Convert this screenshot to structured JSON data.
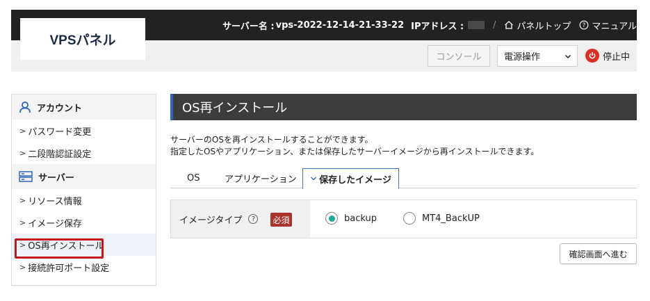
{
  "header": {
    "logo": "VPSパネル",
    "server_name_label": "サーバー名 :",
    "server_name_value": "vps-2022-12-14-21-33-22",
    "ip_label": "IPアドレス :",
    "separator": "/",
    "panel_top_label": "パネルトップ",
    "manual_label": "マニュアル"
  },
  "toolbar": {
    "console_label": "コンソール",
    "power_select_value": "電源操作",
    "status_text": "停止中",
    "status_color": "#d93025"
  },
  "sidebar": {
    "account_heading": "アカウント",
    "account_items": [
      {
        "label": "パスワード変更"
      },
      {
        "label": "二段階認証設定"
      }
    ],
    "server_heading": "サーバー",
    "server_items": [
      {
        "label": "リソース情報"
      },
      {
        "label": "イメージ保存"
      },
      {
        "label": "OS再インストール"
      },
      {
        "label": "接続許可ポート設定"
      }
    ]
  },
  "main": {
    "title": "OS再インストール",
    "desc_line1": "サーバーのOSを再インストールすることができます。",
    "desc_line2": "指定したOSやアプリケーション、または保存したサーバーイメージから再インストールできます。",
    "tabs": [
      {
        "label": "OS"
      },
      {
        "label": "アプリケーション"
      },
      {
        "label": "保存したイメージ"
      }
    ],
    "form": {
      "label": "イメージタイプ",
      "help": "?",
      "required": "必須",
      "options": [
        {
          "label": "backup",
          "selected": true
        },
        {
          "label": "MT4_BackUP",
          "selected": false
        }
      ]
    },
    "confirm_label": "確認画面へ進む"
  },
  "colors": {
    "accent": "#2c64b8",
    "highlight": "#c4161c",
    "radio_selected": "#1fa99a",
    "required_badge": "#a8342d"
  }
}
